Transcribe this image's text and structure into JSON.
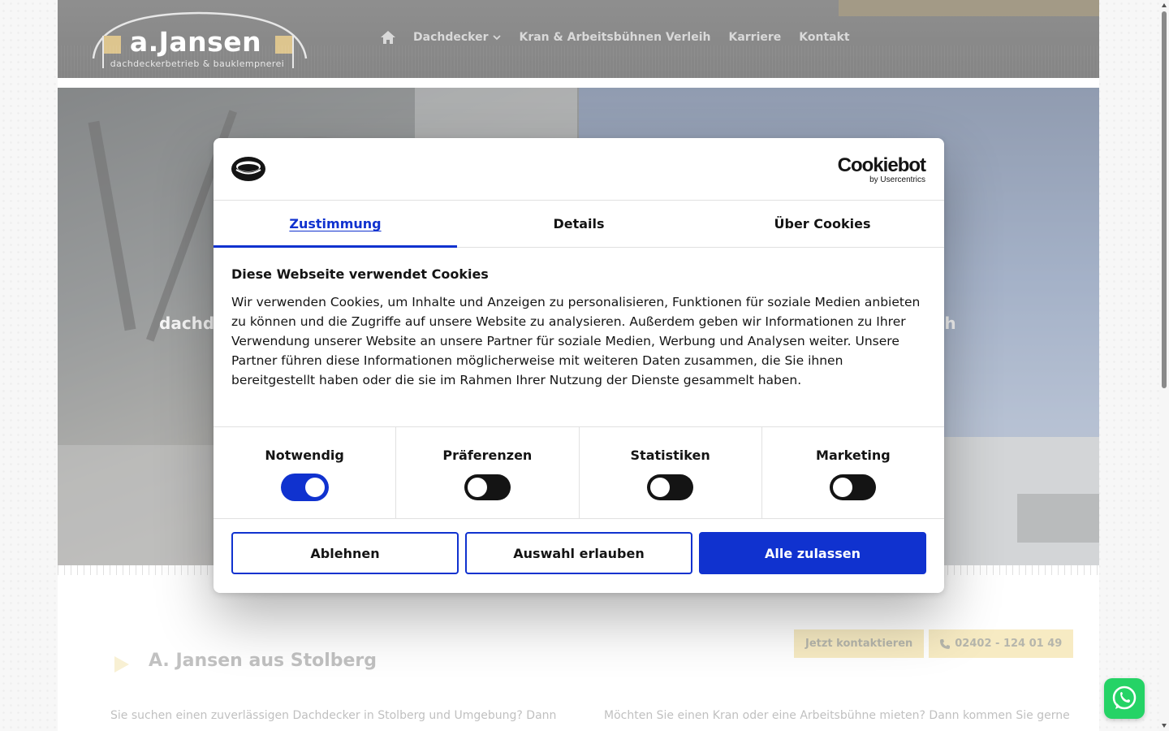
{
  "site": {
    "logo": {
      "name": "a.Jansen",
      "subtitle": "dachdeckerbetrieb & bauklempnerei"
    },
    "nav": [
      {
        "label": "Dachdecker",
        "has_dropdown": true
      },
      {
        "label": "Kran & Arbeitsbühnen Verleih"
      },
      {
        "label": "Karriere"
      },
      {
        "label": "Kontakt"
      }
    ],
    "hero": {
      "left_text": "dachd",
      "right_text": "eih"
    },
    "content": {
      "contact_button": "Jetzt kontaktieren",
      "phone_button": "02402 - 124 01 49",
      "section_title": "A. Jansen aus Stolberg",
      "para_left": "Sie suchen einen zuverlässigen Dachdecker in Stolberg und Umgebung? Dann",
      "para_right": "Möchten Sie einen Kran oder eine Arbeitsbühne mieten? Dann kommen Sie gerne"
    }
  },
  "cookie_dialog": {
    "brand": "Cookiebot",
    "brand_sub": "by Usercentrics",
    "tabs": [
      {
        "label": "Zustimmung",
        "active": true
      },
      {
        "label": "Details",
        "active": false
      },
      {
        "label": "Über Cookies",
        "active": false
      }
    ],
    "title": "Diese Webseite verwendet Cookies",
    "text": "Wir verwenden Cookies, um Inhalte und Anzeigen zu personalisieren, Funktionen für soziale Medien anbieten zu können und die Zugriffe auf unsere Website zu analysieren. Außerdem geben wir Informationen zu Ihrer Verwendung unserer Website an unsere Partner für soziale Medien, Werbung und Analysen weiter. Unsere Partner führen diese Informationen möglicherweise mit weiteren Daten zusammen, die Sie ihnen bereitgestellt haben oder die sie im Rahmen Ihrer Nutzung der Dienste gesammelt haben.",
    "categories": [
      {
        "label": "Notwendig",
        "enabled": true
      },
      {
        "label": "Präferenzen",
        "enabled": false
      },
      {
        "label": "Statistiken",
        "enabled": false
      },
      {
        "label": "Marketing",
        "enabled": false
      }
    ],
    "buttons": {
      "decline": "Ablehnen",
      "allow_selection": "Auswahl erlauben",
      "allow_all": "Alle zulassen"
    }
  },
  "colors": {
    "accent_blue": "#1032cf",
    "header_bg": "#3f3f3f",
    "gold": "#c9a24a",
    "button_yellow": "#f3df9f",
    "whatsapp_green": "#25d366"
  }
}
